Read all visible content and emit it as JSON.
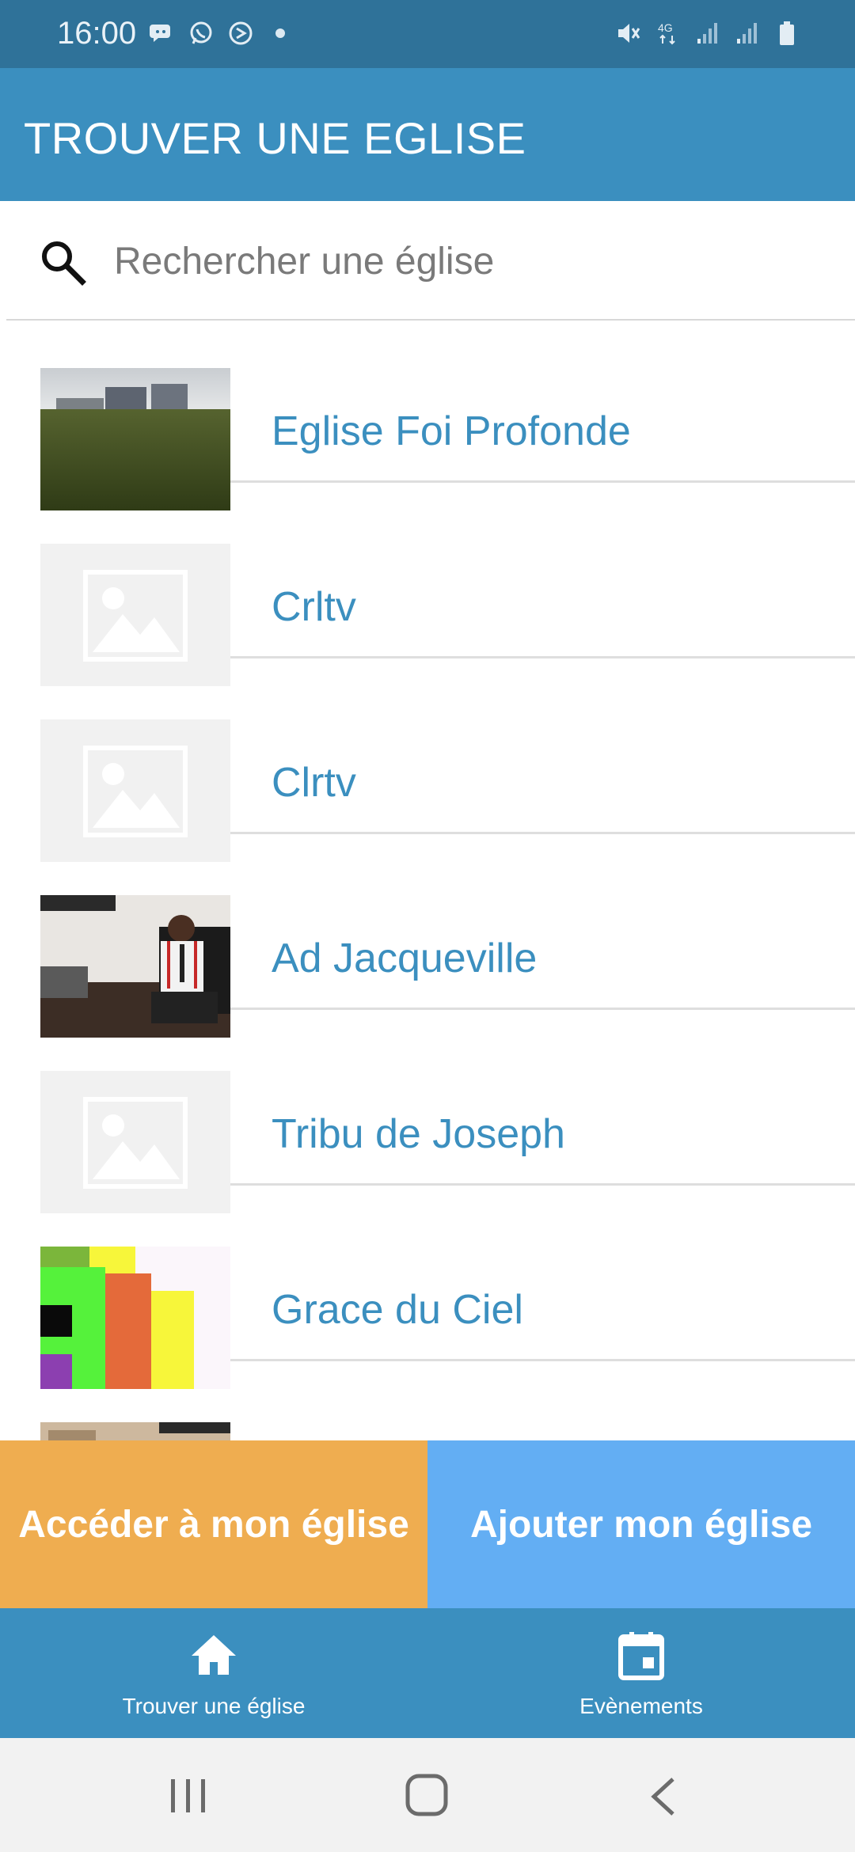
{
  "status_bar": {
    "time": "16:00",
    "left_icons": [
      "messenger-icon",
      "whatsapp-icon",
      "app-icon",
      "dot-icon"
    ],
    "right_icons": [
      "mute-icon",
      "4g-icon",
      "signal-icon",
      "signal-icon",
      "battery-icon"
    ],
    "network_label": "4G"
  },
  "app_bar": {
    "title": "TROUVER UNE EGLISE"
  },
  "search": {
    "placeholder": "Rechercher une église",
    "value": ""
  },
  "churches": [
    {
      "name": "Eglise Foi Profonde",
      "thumbnail": "photo-field"
    },
    {
      "name": "Crltv",
      "thumbnail": "placeholder-image"
    },
    {
      "name": "Clrtv",
      "thumbnail": "placeholder-image"
    },
    {
      "name": "Ad Jacqueville",
      "thumbnail": "photo-man-office"
    },
    {
      "name": "Tribu de Joseph",
      "thumbnail": "placeholder-image"
    },
    {
      "name": "Grace du Ciel",
      "thumbnail": "colorful-logo"
    }
  ],
  "actions": {
    "access_label": "Accéder à mon église",
    "add_label": "Ajouter mon église"
  },
  "bottom_nav": {
    "items": [
      {
        "label": "Trouver une église",
        "icon": "home-icon"
      },
      {
        "label": "Evènements",
        "icon": "calendar-icon"
      }
    ]
  },
  "colors": {
    "status_bar": "#2f7299",
    "primary": "#3b8fbf",
    "accent_orange": "#efad50",
    "accent_blue": "#63aef3",
    "list_text": "#3b8fbf"
  }
}
